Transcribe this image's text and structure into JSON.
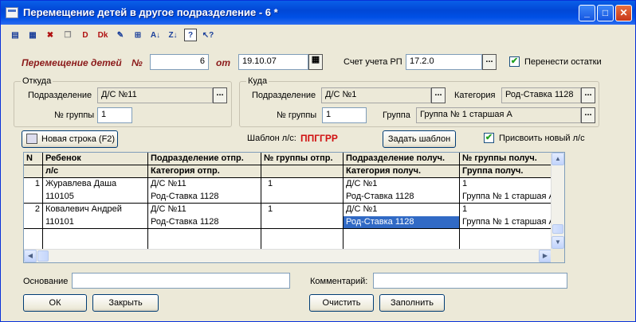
{
  "window": {
    "title": "Перемещение детей в другое подразделение - 6 *",
    "minimize": "_",
    "maximize": "□",
    "close": "✕"
  },
  "toolbar": {
    "icons": [
      "new-row-icon",
      "insert-row-icon",
      "delete-row-icon",
      "copy-row-icon",
      "delete-icon",
      "dk-icon",
      "edit-icon",
      "insert-icon",
      "sort-asc-icon",
      "sort-desc-icon",
      "help-icon",
      "pointer-help-icon"
    ]
  },
  "header": {
    "doc_label": "Перемещение детей",
    "num_label": "№",
    "number": "6",
    "from_label": "от",
    "date": "19.10.07",
    "account_label": "Счет учета РП",
    "account": "17.2.0",
    "transfer_label": "Перенести остатки",
    "transfer_checked": true
  },
  "from": {
    "legend": "Откуда",
    "dept_label": "Подразделение",
    "dept": "Д/С №11",
    "group_label": "№ группы",
    "group": "1"
  },
  "to": {
    "legend": "Куда",
    "dept_label": "Подразделение",
    "dept": "Д/С №1",
    "category_label": "Категория",
    "category": "Род-Ставка 1128",
    "group_num_label": "№ группы",
    "group_num": "1",
    "group_label": "Группа",
    "group": "Группа № 1 старшая А"
  },
  "actions": {
    "new_row": "Новая строка (F2)",
    "template_label": "Шаблон л/с:",
    "template_value": "ППГГРР",
    "set_template": "Задать шаблон",
    "assign_new_label": "Присвоить новый л/с",
    "assign_new_checked": true
  },
  "grid": {
    "headers": [
      [
        "N",
        ""
      ],
      [
        "Ребенок",
        "л/с"
      ],
      [
        "Подразделение отпр.",
        "Категория отпр."
      ],
      [
        "№ группы отпр.",
        ""
      ],
      [
        "Подразделение получ.",
        "Категория получ."
      ],
      [
        "№ группы получ.",
        "Группа получ."
      ]
    ],
    "rows": [
      {
        "n": "1",
        "child": "Журавлева Даша",
        "ls": "110105",
        "dept_from": "Д/С №11",
        "cat_from": "Род-Ставка 1128",
        "grp_from": "1",
        "dept_to": "Д/С №1",
        "cat_to": "Род-Ставка 1128",
        "grp_to_num": "1",
        "grp_to": "Группа № 1 старшая А"
      },
      {
        "n": "2",
        "child": "Ковалевич Андрей",
        "ls": "110101",
        "dept_from": "Д/С №11",
        "cat_from": "Род-Ставка 1128",
        "grp_from": "1",
        "dept_to": "Д/С №1",
        "cat_to": "Род-Ставка 1128",
        "grp_to_num": "1",
        "grp_to": "Группа № 1 старшая А"
      }
    ]
  },
  "footer": {
    "basis_label": "Основание",
    "basis": "",
    "comment_label": "Комментарий:",
    "comment": "",
    "ok": "ОК",
    "close": "Закрыть",
    "clear": "Очистить",
    "fill": "Заполнить"
  }
}
